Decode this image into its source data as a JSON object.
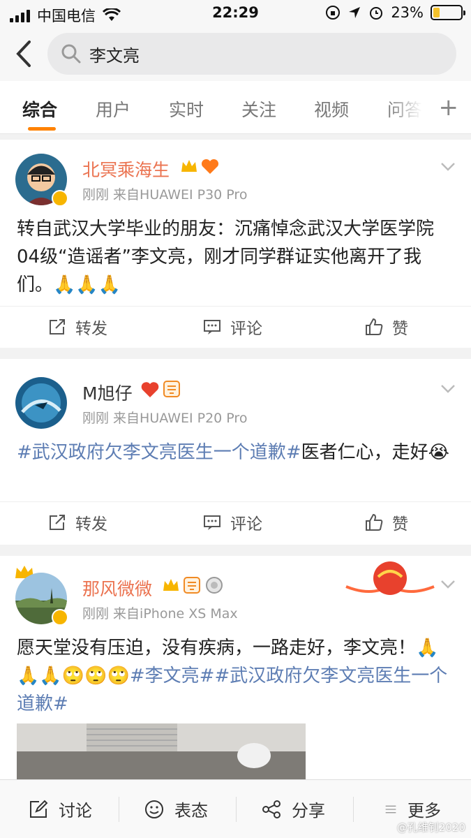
{
  "status": {
    "carrier": "中国电信",
    "time": "22:29",
    "battery": "23%",
    "battery_level": 0.23
  },
  "search": {
    "query": "李文亮"
  },
  "tabs": [
    "综合",
    "用户",
    "实时",
    "关注",
    "视频",
    "问答"
  ],
  "posts": [
    {
      "name": "北冥乘海生",
      "meta": "刚刚  来自HUAWEI P30 Pro",
      "text": "转自武汉大学毕业的朋友：沉痛悼念武汉大学医学院04级“造谣者”李文亮，刚才同学群证实他离开了我们。",
      "emoji": "🙏🙏🙏",
      "repost": "转发",
      "comment": "评论",
      "like": "赞"
    },
    {
      "name": "M旭仔",
      "meta": "刚刚  来自HUAWEI P20 Pro",
      "tag": "#武汉政府欠李文亮医生一个道歉#",
      "text": "医者仁心，走好",
      "emoji": "😭",
      "repost": "转发",
      "comment": "评论",
      "like": "赞"
    },
    {
      "name": "那风微微",
      "meta": "刚刚  来自iPhone XS Max",
      "text": "愿天堂没有压迫，没有疾病，一路走好，李文亮！",
      "emoji": "🙏🙏🙏🙄🙄🙄",
      "tag1": "#李文亮#",
      "tag2": "#武汉政府欠李文亮医生一个道歉#"
    }
  ],
  "bottom": {
    "discuss": "讨论",
    "react": "表态",
    "share": "分享",
    "more": "更多"
  },
  "watermark": "@孔维钊2020",
  "colors": {
    "accent": "#ff8200",
    "name_orange": "#eb7350",
    "topic": "#5d7db3"
  }
}
